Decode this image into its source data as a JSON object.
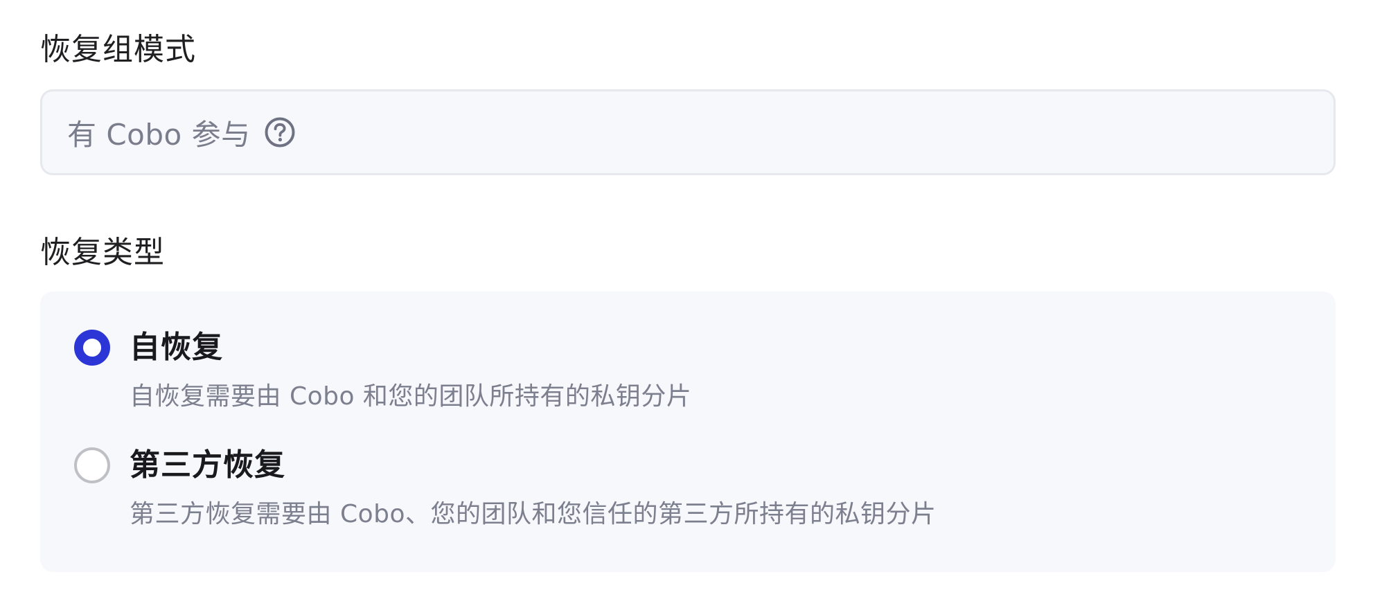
{
  "recovery_group_mode": {
    "label": "恢复组模式",
    "value": "有 Cobo 参与",
    "help_icon": "question-circle-icon"
  },
  "recovery_type": {
    "label": "恢复类型",
    "options": [
      {
        "title": "自恢复",
        "description": "自恢复需要由 Cobo 和您的团队所持有的私钥分片",
        "selected": true
      },
      {
        "title": "第三方恢复",
        "description": "第三方恢复需要由 Cobo、您的团队和您信任的第三方所持有的私钥分片",
        "selected": false
      }
    ]
  },
  "colors": {
    "accent": "#2c35d6",
    "field_background": "#f7f8fc",
    "muted_text": "#7a7d8c"
  }
}
